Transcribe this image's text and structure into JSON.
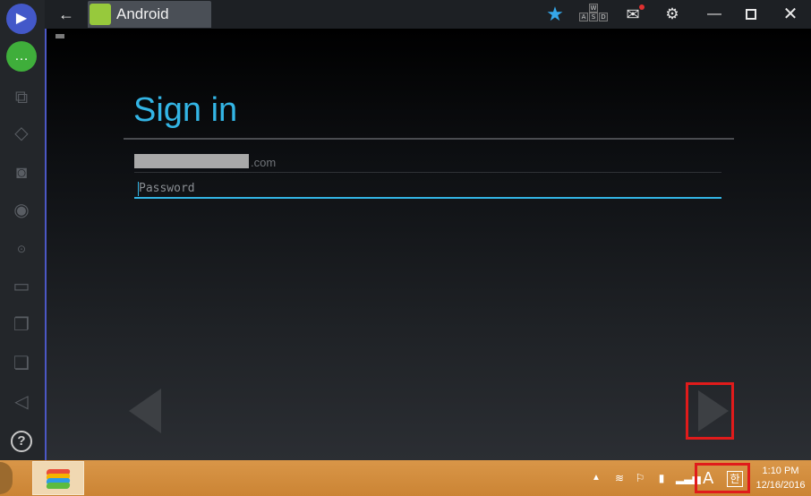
{
  "window": {
    "title": "Android"
  },
  "signin": {
    "title": "Sign in",
    "email_suffix": ".com",
    "password_placeholder": "Password"
  },
  "taskbar": {
    "time": "1:10 PM",
    "date": "12/16/2016",
    "ime_letter": "A",
    "ime_korean": "한"
  },
  "colors": {
    "accent": "#33b5e5",
    "highlight_box": "#e01b1b",
    "star": "#35a7ea"
  },
  "icons": {
    "keyboard_keys": [
      "W",
      "A",
      "S",
      "D"
    ]
  }
}
